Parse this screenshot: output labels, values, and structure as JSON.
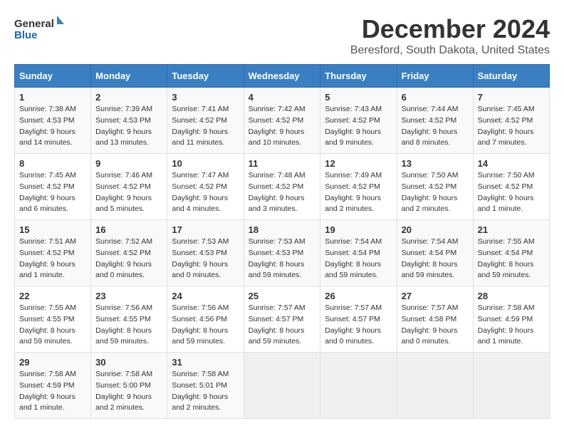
{
  "logo": {
    "general": "General",
    "blue": "Blue"
  },
  "title": "December 2024",
  "location": "Beresford, South Dakota, United States",
  "days_of_week": [
    "Sunday",
    "Monday",
    "Tuesday",
    "Wednesday",
    "Thursday",
    "Friday",
    "Saturday"
  ],
  "weeks": [
    [
      {
        "day": "1",
        "sunrise": "7:38 AM",
        "sunset": "4:53 PM",
        "daylight": "9 hours and 14 minutes."
      },
      {
        "day": "2",
        "sunrise": "7:39 AM",
        "sunset": "4:53 PM",
        "daylight": "9 hours and 13 minutes."
      },
      {
        "day": "3",
        "sunrise": "7:41 AM",
        "sunset": "4:52 PM",
        "daylight": "9 hours and 11 minutes."
      },
      {
        "day": "4",
        "sunrise": "7:42 AM",
        "sunset": "4:52 PM",
        "daylight": "9 hours and 10 minutes."
      },
      {
        "day": "5",
        "sunrise": "7:43 AM",
        "sunset": "4:52 PM",
        "daylight": "9 hours and 9 minutes."
      },
      {
        "day": "6",
        "sunrise": "7:44 AM",
        "sunset": "4:52 PM",
        "daylight": "9 hours and 8 minutes."
      },
      {
        "day": "7",
        "sunrise": "7:45 AM",
        "sunset": "4:52 PM",
        "daylight": "9 hours and 7 minutes."
      }
    ],
    [
      {
        "day": "8",
        "sunrise": "7:45 AM",
        "sunset": "4:52 PM",
        "daylight": "9 hours and 6 minutes."
      },
      {
        "day": "9",
        "sunrise": "7:46 AM",
        "sunset": "4:52 PM",
        "daylight": "9 hours and 5 minutes."
      },
      {
        "day": "10",
        "sunrise": "7:47 AM",
        "sunset": "4:52 PM",
        "daylight": "9 hours and 4 minutes."
      },
      {
        "day": "11",
        "sunrise": "7:48 AM",
        "sunset": "4:52 PM",
        "daylight": "9 hours and 3 minutes."
      },
      {
        "day": "12",
        "sunrise": "7:49 AM",
        "sunset": "4:52 PM",
        "daylight": "9 hours and 2 minutes."
      },
      {
        "day": "13",
        "sunrise": "7:50 AM",
        "sunset": "4:52 PM",
        "daylight": "9 hours and 2 minutes."
      },
      {
        "day": "14",
        "sunrise": "7:50 AM",
        "sunset": "4:52 PM",
        "daylight": "9 hours and 1 minute."
      }
    ],
    [
      {
        "day": "15",
        "sunrise": "7:51 AM",
        "sunset": "4:52 PM",
        "daylight": "9 hours and 1 minute."
      },
      {
        "day": "16",
        "sunrise": "7:52 AM",
        "sunset": "4:52 PM",
        "daylight": "9 hours and 0 minutes."
      },
      {
        "day": "17",
        "sunrise": "7:53 AM",
        "sunset": "4:53 PM",
        "daylight": "9 hours and 0 minutes."
      },
      {
        "day": "18",
        "sunrise": "7:53 AM",
        "sunset": "4:53 PM",
        "daylight": "8 hours and 59 minutes."
      },
      {
        "day": "19",
        "sunrise": "7:54 AM",
        "sunset": "4:54 PM",
        "daylight": "8 hours and 59 minutes."
      },
      {
        "day": "20",
        "sunrise": "7:54 AM",
        "sunset": "4:54 PM",
        "daylight": "8 hours and 59 minutes."
      },
      {
        "day": "21",
        "sunrise": "7:55 AM",
        "sunset": "4:54 PM",
        "daylight": "8 hours and 59 minutes."
      }
    ],
    [
      {
        "day": "22",
        "sunrise": "7:55 AM",
        "sunset": "4:55 PM",
        "daylight": "8 hours and 59 minutes."
      },
      {
        "day": "23",
        "sunrise": "7:56 AM",
        "sunset": "4:55 PM",
        "daylight": "8 hours and 59 minutes."
      },
      {
        "day": "24",
        "sunrise": "7:56 AM",
        "sunset": "4:56 PM",
        "daylight": "8 hours and 59 minutes."
      },
      {
        "day": "25",
        "sunrise": "7:57 AM",
        "sunset": "4:57 PM",
        "daylight": "8 hours and 59 minutes."
      },
      {
        "day": "26",
        "sunrise": "7:57 AM",
        "sunset": "4:57 PM",
        "daylight": "9 hours and 0 minutes."
      },
      {
        "day": "27",
        "sunrise": "7:57 AM",
        "sunset": "4:58 PM",
        "daylight": "9 hours and 0 minutes."
      },
      {
        "day": "28",
        "sunrise": "7:58 AM",
        "sunset": "4:59 PM",
        "daylight": "9 hours and 1 minute."
      }
    ],
    [
      {
        "day": "29",
        "sunrise": "7:58 AM",
        "sunset": "4:59 PM",
        "daylight": "9 hours and 1 minute."
      },
      {
        "day": "30",
        "sunrise": "7:58 AM",
        "sunset": "5:00 PM",
        "daylight": "9 hours and 2 minutes."
      },
      {
        "day": "31",
        "sunrise": "7:58 AM",
        "sunset": "5:01 PM",
        "daylight": "9 hours and 2 minutes."
      },
      null,
      null,
      null,
      null
    ]
  ],
  "labels": {
    "sunrise": "Sunrise:",
    "sunset": "Sunset:",
    "daylight": "Daylight:"
  }
}
